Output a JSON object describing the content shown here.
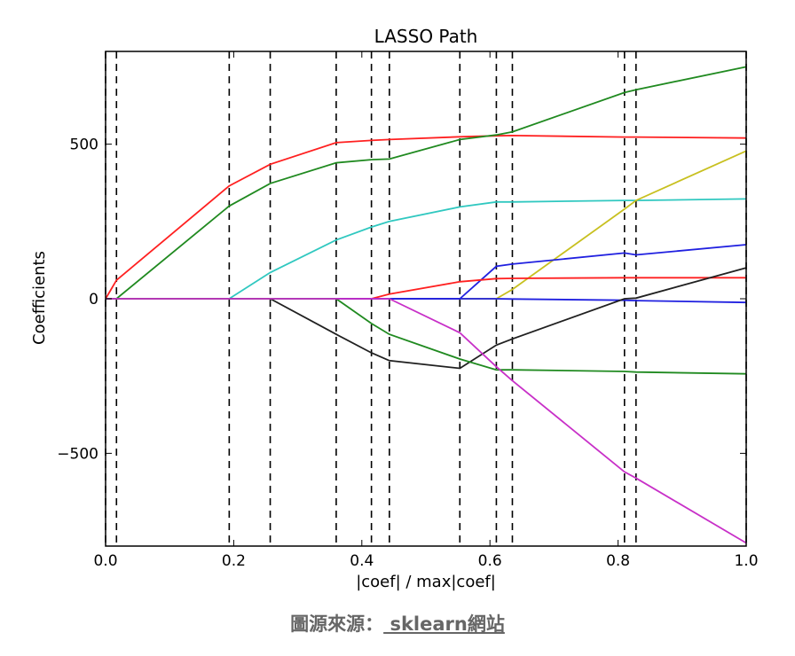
{
  "chart_data": {
    "type": "line",
    "title": "LASSO Path",
    "xlabel": "|coef| / max|coef|",
    "ylabel": "Coefficients",
    "xlim": [
      0.0,
      1.0
    ],
    "ylim": [
      -800,
      800
    ],
    "xticks": [
      0.0,
      0.2,
      0.4,
      0.6,
      0.8,
      1.0
    ],
    "xtick_labels": [
      "0.0",
      "0.2",
      "0.4",
      "0.6",
      "0.8",
      "1.0"
    ],
    "yticks": [
      500,
      0,
      -500
    ],
    "ytick_labels": [
      "500",
      "0",
      "−500"
    ],
    "grid": false,
    "vlines": [
      0.0,
      0.017,
      0.193,
      0.257,
      0.36,
      0.415,
      0.443,
      0.553,
      0.61,
      0.635,
      0.81,
      0.828,
      1.0
    ],
    "series": [
      {
        "color": "#ff2020",
        "points": [
          [
            0,
            0
          ],
          [
            0.017,
            60
          ],
          [
            0.193,
            365
          ],
          [
            0.257,
            435
          ],
          [
            0.36,
            505
          ],
          [
            0.415,
            512
          ],
          [
            0.443,
            515
          ],
          [
            0.553,
            524
          ],
          [
            0.61,
            527
          ],
          [
            0.635,
            528
          ],
          [
            0.81,
            523
          ],
          [
            0.828,
            523
          ],
          [
            1.0,
            520
          ]
        ]
      },
      {
        "color": "#208a20",
        "points": [
          [
            0,
            0
          ],
          [
            0.017,
            0
          ],
          [
            0.193,
            300
          ],
          [
            0.257,
            373
          ],
          [
            0.36,
            440
          ],
          [
            0.415,
            450
          ],
          [
            0.443,
            452
          ],
          [
            0.553,
            515
          ],
          [
            0.61,
            530
          ],
          [
            0.635,
            540
          ],
          [
            0.81,
            667
          ],
          [
            0.828,
            676
          ],
          [
            1.0,
            750
          ]
        ]
      },
      {
        "color": "#30c8c0",
        "points": [
          [
            0,
            0
          ],
          [
            0.193,
            0
          ],
          [
            0.257,
            85
          ],
          [
            0.36,
            190
          ],
          [
            0.415,
            232
          ],
          [
            0.443,
            250
          ],
          [
            0.553,
            297
          ],
          [
            0.61,
            313
          ],
          [
            0.635,
            313
          ],
          [
            0.81,
            318
          ],
          [
            0.828,
            318
          ],
          [
            1.0,
            323
          ]
        ]
      },
      {
        "color": "#c8c020",
        "points": [
          [
            0,
            0
          ],
          [
            0.61,
            0
          ],
          [
            0.635,
            30
          ],
          [
            0.81,
            290
          ],
          [
            0.828,
            318
          ],
          [
            1.0,
            478
          ]
        ]
      },
      {
        "color": "#2020e0",
        "points": [
          [
            0,
            0
          ],
          [
            0.553,
            0
          ],
          [
            0.61,
            105
          ],
          [
            0.635,
            112
          ],
          [
            0.81,
            148
          ],
          [
            0.828,
            142
          ],
          [
            1.0,
            175
          ]
        ]
      },
      {
        "color": "#ff2020",
        "points": [
          [
            0,
            0
          ],
          [
            0.415,
            0
          ],
          [
            0.443,
            15
          ],
          [
            0.553,
            55
          ],
          [
            0.61,
            65
          ],
          [
            0.635,
            66
          ],
          [
            0.81,
            68
          ],
          [
            0.828,
            68
          ],
          [
            1.0,
            68
          ]
        ]
      },
      {
        "color": "#2020e0",
        "points": [
          [
            0,
            0
          ],
          [
            0.61,
            0
          ],
          [
            0.635,
            -1
          ],
          [
            0.81,
            -5
          ],
          [
            0.828,
            -6
          ],
          [
            1.0,
            -12
          ]
        ]
      },
      {
        "color": "#202020",
        "points": [
          [
            0,
            0
          ],
          [
            0.257,
            0
          ],
          [
            0.36,
            -115
          ],
          [
            0.415,
            -175
          ],
          [
            0.443,
            -200
          ],
          [
            0.553,
            -225
          ],
          [
            0.61,
            -150
          ],
          [
            0.635,
            -130
          ],
          [
            0.81,
            0
          ],
          [
            0.828,
            2
          ],
          [
            1.0,
            100
          ]
        ]
      },
      {
        "color": "#208a20",
        "points": [
          [
            0,
            0
          ],
          [
            0.36,
            0
          ],
          [
            0.415,
            -80
          ],
          [
            0.443,
            -115
          ],
          [
            0.553,
            -195
          ],
          [
            0.61,
            -230
          ],
          [
            0.635,
            -230
          ],
          [
            0.81,
            -235
          ],
          [
            0.828,
            -237
          ],
          [
            1.0,
            -243
          ]
        ]
      },
      {
        "color": "#c830c8",
        "points": [
          [
            0,
            0
          ],
          [
            0.443,
            0
          ],
          [
            0.553,
            -110
          ],
          [
            0.61,
            -220
          ],
          [
            0.635,
            -265
          ],
          [
            0.81,
            -560
          ],
          [
            0.828,
            -580
          ],
          [
            1.0,
            -790
          ]
        ]
      }
    ]
  },
  "caption": {
    "prefix": "圖源來源：",
    "link_text": " sklearn網站"
  }
}
